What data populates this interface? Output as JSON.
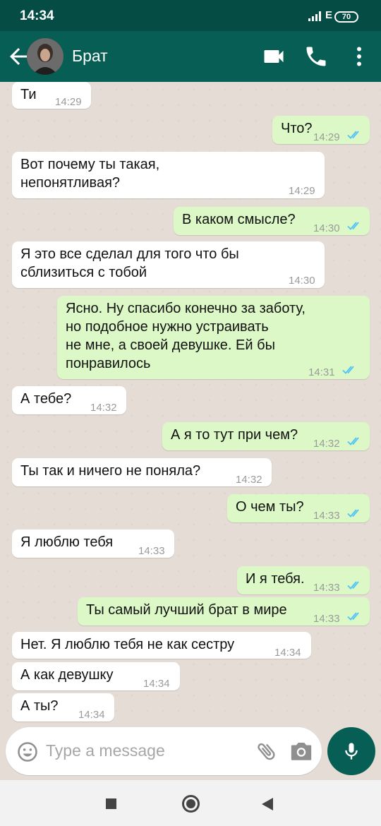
{
  "status_bar": {
    "time": "14:34",
    "network": "E",
    "battery": "70"
  },
  "header": {
    "contact_name": "Брат",
    "back_icon": "arrow-left-icon",
    "video_icon": "videocam-icon",
    "call_icon": "phone-icon",
    "menu_icon": "more-vert-icon"
  },
  "messages": [
    {
      "dir": "in",
      "text": "Ти",
      "time": "14:29"
    },
    {
      "dir": "out",
      "text": "Что?",
      "time": "14:29"
    },
    {
      "dir": "in",
      "text": "Вот почему ты такая,\nнепонятливая?",
      "time": "14:29"
    },
    {
      "dir": "out",
      "text": "В каком смысле?",
      "time": "14:30"
    },
    {
      "dir": "in",
      "text": "Я это все сделал для того что бы\nсблизиться с тобой",
      "time": "14:30"
    },
    {
      "dir": "out",
      "text": "Ясно. Ну спасибо конечно за заботу,\nно подобное нужно устраивать\nне мне, а своей девушке. Ей бы\nпонравилось",
      "time": "14:31"
    },
    {
      "dir": "in",
      "text": "А тебе?",
      "time": "14:32"
    },
    {
      "dir": "out",
      "text": "А я то тут при чем?",
      "time": "14:32"
    },
    {
      "dir": "in",
      "text": "Ты так и ничего не поняла?",
      "time": "14:32"
    },
    {
      "dir": "out",
      "text": "О чем ты?",
      "time": "14:33"
    },
    {
      "dir": "in",
      "text": "Я люблю тебя",
      "time": "14:33"
    },
    {
      "dir": "out",
      "text": "И я тебя.",
      "time": "14:33"
    },
    {
      "dir": "out",
      "text": "Ты самый лучший брат в мире",
      "time": "14:33"
    },
    {
      "dir": "in",
      "text": "Нет. Я люблю тебя не как сестру",
      "time": "14:34"
    },
    {
      "dir": "in",
      "text": "А как девушку",
      "time": "14:34"
    },
    {
      "dir": "in",
      "text": "А ты?",
      "time": "14:34"
    }
  ],
  "input": {
    "placeholder": "Type a message",
    "emoji_icon": "emoji-icon",
    "attach_icon": "paperclip-icon",
    "camera_icon": "camera-icon",
    "mic_icon": "mic-icon"
  },
  "colors": {
    "header": "#075e54",
    "status_bar": "#054d44",
    "outgoing_bubble": "#dcf8c6",
    "incoming_bubble": "#ffffff",
    "read_ticks": "#4fc3f7",
    "background": "#e5ddd5"
  }
}
